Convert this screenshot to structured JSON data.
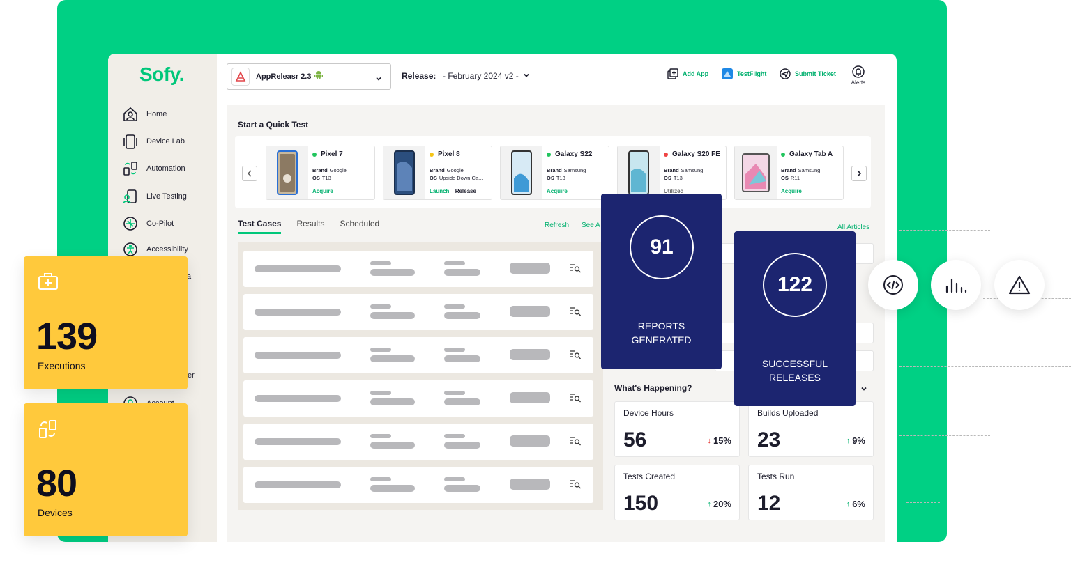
{
  "app": {
    "logo": "Sofy.",
    "app_selector": "AppReleasr 2.3",
    "release_label": "Release:",
    "release_value": "- February 2024 v2 -"
  },
  "top_actions": {
    "add_app": "Add App",
    "testflight": "TestFlight",
    "submit_ticket": "Submit Ticket",
    "alerts": "Alerts"
  },
  "sidebar": {
    "items": [
      {
        "label": "Home",
        "icon": "home-icon"
      },
      {
        "label": "Device Lab",
        "icon": "device-icon"
      },
      {
        "label": "Automation",
        "icon": "automation-icon"
      },
      {
        "label": "Live Testing",
        "icon": "live-testing-icon"
      },
      {
        "label": "Co-Pilot",
        "icon": "copilot-icon"
      },
      {
        "label": "Accessibility",
        "icon": "accessibility-icon"
      }
    ],
    "partial_1": "a",
    "partial_2": "er",
    "partial_3": "Account"
  },
  "quick_test": {
    "title": "Start a Quick Test",
    "devices": [
      {
        "name": "Pixel 7",
        "status_color": "#22c55e",
        "brand_label": "Brand",
        "brand": "Google",
        "os_label": "OS",
        "os": "T13",
        "action": "Acquire",
        "action2": ""
      },
      {
        "name": "Pixel 8",
        "status_color": "#f5c518",
        "brand_label": "Brand",
        "brand": "Google",
        "os_label": "OS",
        "os": "Upside Down Ca...",
        "action": "Launch",
        "action2": "Release"
      },
      {
        "name": "Galaxy S22",
        "status_color": "#22c55e",
        "brand_label": "Brand",
        "brand": "Samsung",
        "os_label": "OS",
        "os": "T13",
        "action": "Acquire",
        "action2": ""
      },
      {
        "name": "Galaxy S20 FE",
        "status_color": "#ef4444",
        "brand_label": "Brand",
        "brand": "Samsung",
        "os_label": "OS",
        "os": "T13",
        "action": "Utilized",
        "action2": ""
      },
      {
        "name": "Galaxy Tab A",
        "status_color": "#22c55e",
        "brand_label": "Brand",
        "brand": "Samsung",
        "os_label": "OS",
        "os": "R11",
        "action": "Acquire",
        "action2": ""
      }
    ]
  },
  "tabs": [
    "Test Cases",
    "Results",
    "Scheduled"
  ],
  "links": {
    "refresh": "Refresh",
    "see_all": "See A",
    "all_articles": "All Articles"
  },
  "whats_happening": {
    "title": "What's Happening?",
    "dropdown_fragment": "k",
    "metrics": [
      {
        "title": "Device Hours",
        "value": "56",
        "change": "15%",
        "direction": "down"
      },
      {
        "title": "Builds Uploaded",
        "value": "23",
        "change": "9%",
        "direction": "up"
      },
      {
        "title": "Tests Created",
        "value": "150",
        "change": "20%",
        "direction": "up"
      },
      {
        "title": "Tests Run",
        "value": "12",
        "change": "6%",
        "direction": "up"
      }
    ]
  },
  "overlays": {
    "reports_value": "91",
    "reports_label_1": "REPORTS",
    "reports_label_2": "GENERATED",
    "releases_value": "122",
    "releases_label_1": "SUCCESSFUL",
    "releases_label_2": "RELEASES"
  },
  "stat_cards": [
    {
      "value": "139",
      "label": "Executions",
      "icon": "first-aid-box-icon"
    },
    {
      "value": "80",
      "label": "Devices",
      "icon": "device-swap-icon"
    }
  ],
  "floating_icons": [
    "code-icon",
    "bar-chart-icon",
    "warning-icon"
  ],
  "colors": {
    "brand_green": "#00d084",
    "navy": "#1c2570",
    "yellow": "#ffc93c",
    "link_green": "#00b06e",
    "down_red": "#e53935"
  }
}
